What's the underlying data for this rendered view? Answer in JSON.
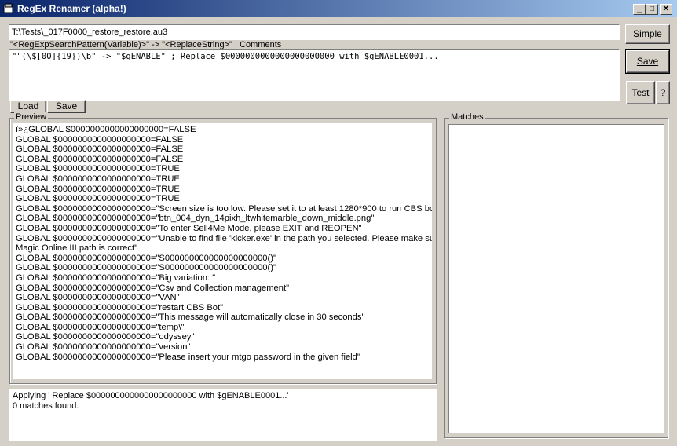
{
  "window": {
    "title": "RegEx Renamer (alpha!)",
    "controls": {
      "minimize": "_",
      "maximize": "□",
      "close": "✕"
    }
  },
  "file_path": {
    "value": "T:\\Tests\\_017F0000_restore_restore.au3"
  },
  "buttons": {
    "simple": "Simple",
    "save_top": "Save",
    "test": "Test",
    "help": "?",
    "load": "Load",
    "save_small": "Save"
  },
  "pattern_hint": "\"<RegExpSearchPattern(Variable)>\" -> \"<ReplaceString>\" ; Comments",
  "pattern_text": "\"\"(\\$[0O]{19})\\b\" -> \"$gENABLE\" ; Replace $0000000000000000000000 with $gENABLE0001...",
  "preview": {
    "label": "Preview",
    "lines": [
      "ï»¿GLOBAL $0000000000000000000=FALSE",
      "GLOBAL $0000000000000000000=FALSE",
      "GLOBAL $0000000000000000000=FALSE",
      "GLOBAL $0000000000000000000=FALSE",
      "GLOBAL $0000000000000000000=TRUE",
      "GLOBAL $0000000000000000000=TRUE",
      "GLOBAL $0000000000000000000=TRUE",
      "GLOBAL $0000000000000000000=TRUE",
      "GLOBAL $0000000000000000000=\"Screen size is too low. Please set it to at least 1280*900 to run CBS bot\"",
      "GLOBAL $0000000000000000000=\"btn_004_dyn_14pixh_ltwhitemarble_down_middle.png\"",
      "GLOBAL $0000000000000000000=\"To enter Sell4Me Mode, please EXIT and REOPEN\"",
      "GLOBAL $0000000000000000000=\"Unable to find file 'kicker.exe' in the path you selected. Please make sure",
      "Magic Online III path is correct\"",
      "GLOBAL $0000000000000000000=\"S000000000000000000000()\"",
      "GLOBAL $0000000000000000000=\"S000000000000000000000()\"",
      "GLOBAL $0000000000000000000=\"Big variation: \"",
      "GLOBAL $0000000000000000000=\"Csv and Collection management\"",
      "GLOBAL $0000000000000000000=\"VAN\"",
      "GLOBAL $0000000000000000000=\"restart CBS Bot\"",
      "GLOBAL $0000000000000000000=\"This message will automatically close in 30 seconds\"",
      "GLOBAL $0000000000000000000=\"temp\\\"",
      "GLOBAL $0000000000000000000=\"odyssey\"",
      "GLOBAL $0000000000000000000=\"version\"",
      "GLOBAL $0000000000000000000=\"Please insert your mtgo password in the given field\""
    ]
  },
  "log": {
    "lines": [
      "Applying ' Replace $0000000000000000000000 with $gENABLE0001...'",
      "0 matches found."
    ]
  },
  "matches": {
    "label": "Matches"
  },
  "colors": {
    "face": "#d4d0c8",
    "title_start": "#0a246a",
    "title_end": "#a6caf0"
  }
}
